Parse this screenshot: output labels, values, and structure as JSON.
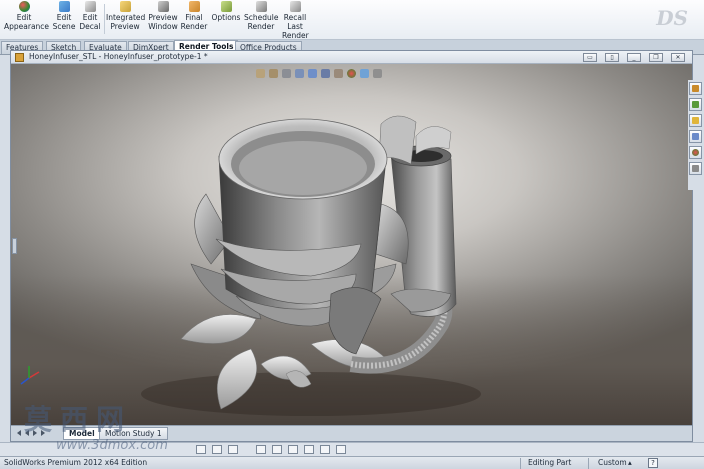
{
  "ribbon": {
    "buttons": [
      {
        "label": "Edit\nAppearance",
        "icon": "appearance-ball-icon",
        "color": "#2f8a2f"
      },
      {
        "label": "Edit\nScene",
        "icon": "scene-icon",
        "color": "#3a7ac8"
      },
      {
        "label": "Edit\nDecal",
        "icon": "decal-icon",
        "color": "#8a8a8a"
      },
      {
        "label": "Integrated\nPreview",
        "icon": "integrated-preview-icon",
        "color": "#c8a23a"
      },
      {
        "label": "Preview\nWindow",
        "icon": "preview-window-icon",
        "color": "#6a6a6a"
      },
      {
        "label": "Final\nRender",
        "icon": "final-render-icon",
        "color": "#c8842a"
      },
      {
        "label": "Options",
        "icon": "options-icon",
        "color": "#7a9a3a"
      },
      {
        "label": "Schedule\nRender",
        "icon": "schedule-render-icon",
        "color": "#7a7a7a"
      },
      {
        "label": "Recall\nLast\nRender",
        "icon": "recall-render-icon",
        "color": "#8a8a8a"
      }
    ]
  },
  "command_tabs": [
    "Features",
    "Sketch",
    "Evaluate",
    "DimXpert",
    "Render Tools",
    "Office Products"
  ],
  "document": {
    "title": "HoneyInfuser_STL - HoneyInfuser_prototype-1 *"
  },
  "bottom_tabs": [
    "Model",
    "Motion Study 1"
  ],
  "status_bar": {
    "product": "SolidWorks Premium 2012 x64 Edition",
    "mode": "Editing Part",
    "units": "Custom",
    "help": "?"
  },
  "watermark": {
    "text": "莫西网",
    "url": "www.3dmox.com"
  }
}
